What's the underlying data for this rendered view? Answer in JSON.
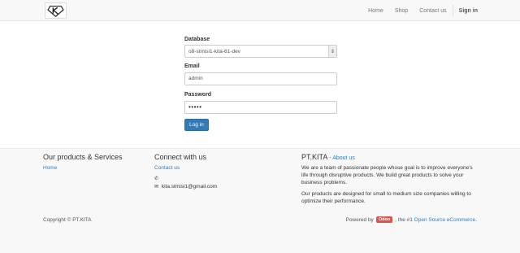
{
  "nav": {
    "home": "Home",
    "shop": "Shop",
    "contact": "Contact us",
    "signin": "Sign in"
  },
  "login": {
    "database_label": "Database",
    "database_value": "o8-stmisi1-kita-61-dev",
    "email_label": "Email",
    "email_value": "admin",
    "password_label": "Password",
    "password_value": "•••••",
    "login_button": "Log in"
  },
  "footer": {
    "products_title": "Our products & Services",
    "products_home": "Home",
    "connect_title": "Connect with us",
    "connect_contact": "Contact us",
    "email": "kita.stmisi1@gmail.com",
    "about_title": "PT.KITA",
    "about_sep": " - ",
    "about_link": "About us",
    "about_p1": "We are a team of passionate people whose goal is to improve everyone's life through disruptive products. We build great products to solve your business problems.",
    "about_p2": "Our products are designed for small to medium size companies willing to optimize their performance.",
    "copyright": "Copyright © PT.KITA",
    "powered_prefix": "Powered by",
    "powered_brand": "Odoo",
    "powered_mid": ", the #1",
    "powered_link": "Open Source eCommerce",
    "powered_end": "."
  },
  "colors": {
    "link": "#337ab7",
    "button": "#337ab7",
    "odoo_badge": "#d9534f"
  },
  "icons": {
    "phone": "phone-icon",
    "mail": "envelope-icon",
    "select": "chevron-updown-icon"
  }
}
